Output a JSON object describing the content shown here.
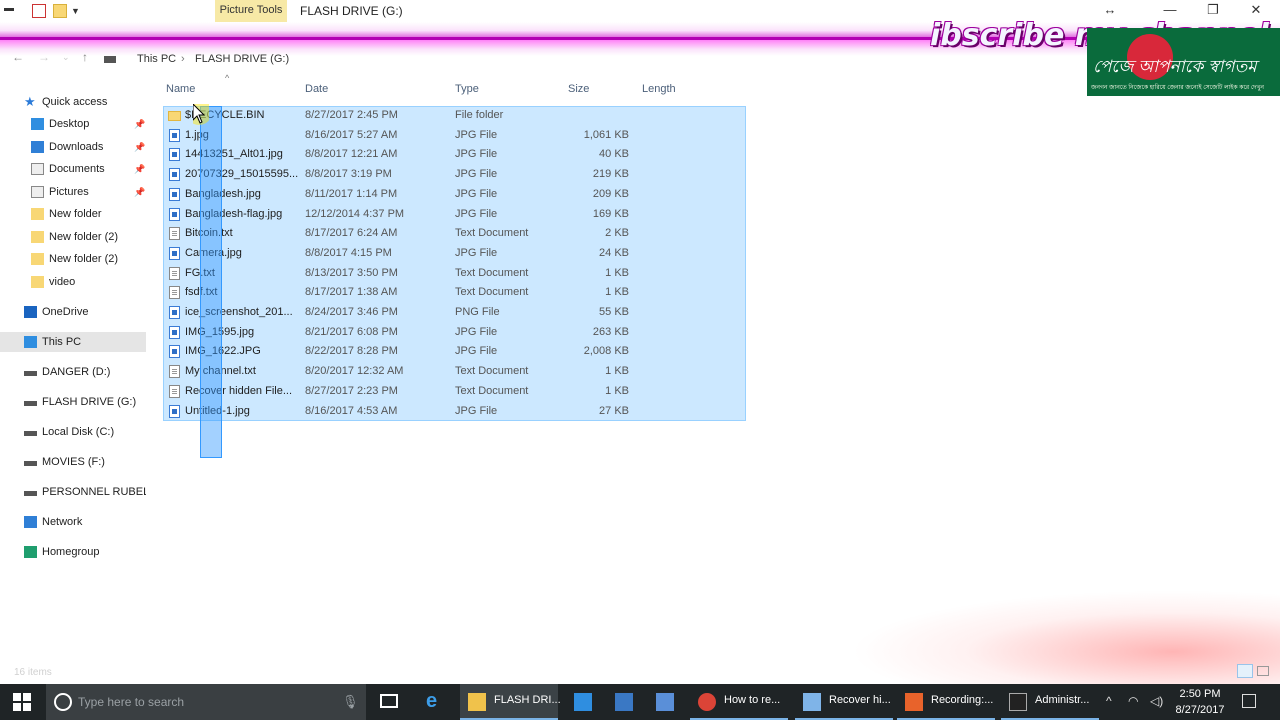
{
  "window": {
    "context_tab": "Picture Tools",
    "title": "FLASH DRIVE (G:)"
  },
  "overlay": {
    "banner_text": "ibscribe my channel",
    "logo_text": "পেজে আপনাকে স্বাগতম",
    "logo_sub": "জনগন জানতে নিজেকে হারিয়ে জেনার জন্যেই সেজেটি লাইক করে দেখুন"
  },
  "breadcrumb": [
    "This PC",
    "FLASH DRIVE (G:)"
  ],
  "columns": {
    "name": "Name",
    "date": "Date",
    "type": "Type",
    "size": "Size",
    "length": "Length"
  },
  "sidebar": {
    "items": [
      {
        "label": "Quick access",
        "icon": "star-icon"
      },
      {
        "label": "Desktop",
        "icon": "desktop-icon",
        "pinned": true
      },
      {
        "label": "Downloads",
        "icon": "download-icon",
        "pinned": true
      },
      {
        "label": "Documents",
        "icon": "documents-icon",
        "pinned": true
      },
      {
        "label": "Pictures",
        "icon": "pictures-icon",
        "pinned": true
      },
      {
        "label": "New folder",
        "icon": "folder-icon"
      },
      {
        "label": "New folder (2)",
        "icon": "folder-icon"
      },
      {
        "label": "New folder (2)",
        "icon": "folder-icon"
      },
      {
        "label": "video",
        "icon": "folder-icon"
      },
      {
        "label": "OneDrive",
        "icon": "cloud-icon"
      },
      {
        "label": "This PC",
        "icon": "computer-icon",
        "selected": true
      },
      {
        "label": "DANGER (D:)",
        "icon": "drive-icon"
      },
      {
        "label": "FLASH DRIVE (G:)",
        "icon": "drive-icon"
      },
      {
        "label": "Local Disk (C:)",
        "icon": "drive-icon"
      },
      {
        "label": "MOVIES (F:)",
        "icon": "drive-icon"
      },
      {
        "label": "PERSONNEL RUBEL (I",
        "icon": "drive-icon"
      },
      {
        "label": "Network",
        "icon": "network-icon"
      },
      {
        "label": "Homegroup",
        "icon": "homegroup-icon"
      }
    ]
  },
  "files": [
    {
      "name": "$RECYCLE.BIN",
      "date": "8/27/2017 2:45 PM",
      "type": "File folder",
      "size": "",
      "kind": "folder"
    },
    {
      "name": "1.jpg",
      "date": "8/16/2017 5:27 AM",
      "type": "JPG File",
      "size": "1,061 KB",
      "kind": "img"
    },
    {
      "name": "14413251_Alt01.jpg",
      "date": "8/8/2017 12:21 AM",
      "type": "JPG File",
      "size": "40 KB",
      "kind": "img"
    },
    {
      "name": "20707329_15015595...",
      "date": "8/8/2017 3:19 PM",
      "type": "JPG File",
      "size": "219 KB",
      "kind": "img"
    },
    {
      "name": "Bangladesh.jpg",
      "date": "8/11/2017 1:14 PM",
      "type": "JPG File",
      "size": "209 KB",
      "kind": "img"
    },
    {
      "name": "Bangladesh-flag.jpg",
      "date": "12/12/2014 4:37 PM",
      "type": "JPG File",
      "size": "169 KB",
      "kind": "img"
    },
    {
      "name": "Bitcoin.txt",
      "date": "8/17/2017 6:24 AM",
      "type": "Text Document",
      "size": "2 KB",
      "kind": "txt"
    },
    {
      "name": "Camera.jpg",
      "date": "8/8/2017 4:15 PM",
      "type": "JPG File",
      "size": "24 KB",
      "kind": "img"
    },
    {
      "name": "FG.txt",
      "date": "8/13/2017 3:50 PM",
      "type": "Text Document",
      "size": "1 KB",
      "kind": "txt"
    },
    {
      "name": "fsdf.txt",
      "date": "8/17/2017 1:38 AM",
      "type": "Text Document",
      "size": "1 KB",
      "kind": "txt"
    },
    {
      "name": "ice_screenshot_201...",
      "date": "8/24/2017 3:46 PM",
      "type": "PNG File",
      "size": "55 KB",
      "kind": "img"
    },
    {
      "name": "IMG_1595.jpg",
      "date": "8/21/2017 6:08 PM",
      "type": "JPG File",
      "size": "263 KB",
      "kind": "img"
    },
    {
      "name": "IMG_1622.JPG",
      "date": "8/22/2017 8:28 PM",
      "type": "JPG File",
      "size": "2,008 KB",
      "kind": "img"
    },
    {
      "name": "My channel.txt",
      "date": "8/20/2017 12:32 AM",
      "type": "Text Document",
      "size": "1 KB",
      "kind": "txt"
    },
    {
      "name": "Recover hidden File...",
      "date": "8/27/2017 2:23 PM",
      "type": "Text Document",
      "size": "1 KB",
      "kind": "txt"
    },
    {
      "name": "Untitled-1.jpg",
      "date": "8/16/2017 4:53 AM",
      "type": "JPG File",
      "size": "27 KB",
      "kind": "img"
    }
  ],
  "status": {
    "items": "16 items"
  },
  "taskbar": {
    "search_placeholder": "Type here to search",
    "apps": [
      {
        "label": "FLASH DRI...",
        "icon": "file-explorer-icon",
        "state": "active"
      },
      {
        "label": "",
        "icon": "ie-icon",
        "state": ""
      },
      {
        "label": "",
        "icon": "calculator-icon",
        "state": ""
      },
      {
        "label": "",
        "icon": "remote-desktop-icon",
        "state": ""
      },
      {
        "label": "How to re...",
        "icon": "chrome-icon",
        "state": "open"
      },
      {
        "label": "Recover hi...",
        "icon": "notepad-icon",
        "state": "open"
      },
      {
        "label": "Recording:...",
        "icon": "recorder-icon",
        "state": "open"
      },
      {
        "label": "Administr...",
        "icon": "cmd-icon",
        "state": "open"
      }
    ],
    "time": "2:50 PM",
    "date": "8/27/2017"
  },
  "colors": {
    "selection": "#cce8ff",
    "drag_rect": "#3399ff",
    "banner": "#b300b3",
    "taskbar": "#1f2426"
  }
}
